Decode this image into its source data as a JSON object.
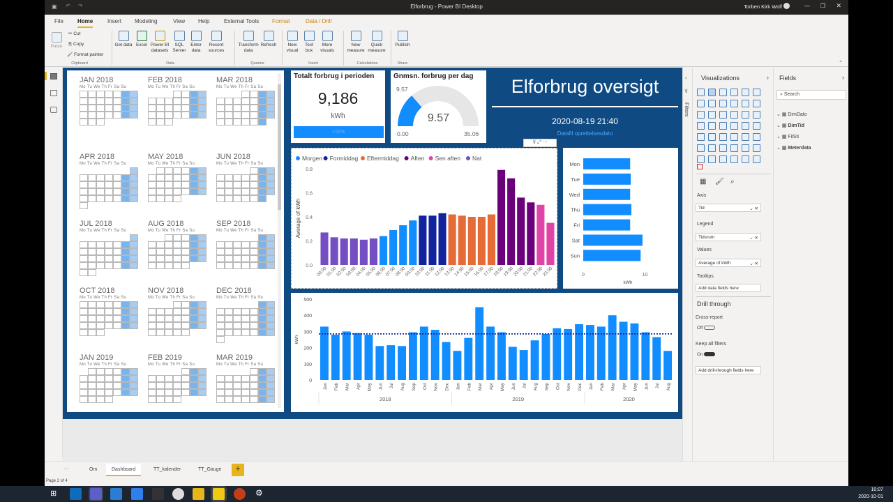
{
  "window": {
    "title": "Elforbrug - Power BI Desktop",
    "user": "Torben Kirk Wolf"
  },
  "ribbon_tabs": [
    "File",
    "Home",
    "Insert",
    "Modeling",
    "View",
    "Help",
    "External Tools",
    "Format",
    "Data / Drill"
  ],
  "ribbon": {
    "clipboard": {
      "paste": "Paste",
      "cut": "Cut",
      "copy": "Copy",
      "format_painter": "Format painter",
      "group": "Clipboard"
    },
    "data": {
      "items": [
        "Get data",
        "Excel",
        "Power BI datasets",
        "SQL Server",
        "Enter data",
        "Recent sources"
      ],
      "group": "Data"
    },
    "queries": {
      "items": [
        "Transform data",
        "Refresh"
      ],
      "group": "Queries"
    },
    "insert": {
      "items": [
        "New visual",
        "Text box",
        "More visuals"
      ],
      "group": "Insert"
    },
    "calculations": {
      "items": [
        "New measure",
        "Quick measure"
      ],
      "group": "Calculations"
    },
    "share": {
      "items": [
        "Publish"
      ],
      "group": "Share"
    }
  },
  "calendar": {
    "dow_header": "Mo Tu We Th Fr Sa Su",
    "months": [
      {
        "name": "JAN 2018",
        "offset": 0,
        "days": 31
      },
      {
        "name": "FEB 2018",
        "offset": 3,
        "days": 28
      },
      {
        "name": "MAR 2018",
        "offset": 3,
        "days": 31
      },
      {
        "name": "APR 2018",
        "offset": 6,
        "days": 30
      },
      {
        "name": "MAY 2018",
        "offset": 1,
        "days": 31
      },
      {
        "name": "JUN 2018",
        "offset": 4,
        "days": 30
      },
      {
        "name": "JUL 2018",
        "offset": 6,
        "days": 31
      },
      {
        "name": "AUG 2018",
        "offset": 2,
        "days": 31
      },
      {
        "name": "SEP 2018",
        "offset": 5,
        "days": 30
      },
      {
        "name": "OCT 2018",
        "offset": 0,
        "days": 31
      },
      {
        "name": "NOV 2018",
        "offset": 3,
        "days": 30
      },
      {
        "name": "DEC 2018",
        "offset": 5,
        "days": 31
      },
      {
        "name": "JAN 2019",
        "offset": 1,
        "days": 31
      },
      {
        "name": "FEB 2019",
        "offset": 4,
        "days": 28
      },
      {
        "name": "MAR 2019",
        "offset": 4,
        "days": 31
      }
    ]
  },
  "kpi": {
    "title": "Totalt forbrug i perioden",
    "value": "9,186",
    "unit": "kWh",
    "bar_text": "100%"
  },
  "gauge": {
    "title": "Gnmsn. forbrug per dag",
    "value": "9.57",
    "target": "9.57",
    "min": "0.00",
    "max": "35.06",
    "fill_fraction": 0.273
  },
  "header": {
    "title": "Elforbrug oversigt",
    "datetime": "2020-08-19 21:40",
    "subtitle": "Datafil oprettelsesdato"
  },
  "hourly_chart": {
    "legend": [
      {
        "name": "Morgen",
        "color": "#118DFF"
      },
      {
        "name": "Formiddag",
        "color": "#12239E"
      },
      {
        "name": "Eftermiddag",
        "color": "#E66C37"
      },
      {
        "name": "Aften",
        "color": "#6B007B"
      },
      {
        "name": "Sen aften",
        "color": "#E044A7"
      },
      {
        "name": "Nat",
        "color": "#744EC2"
      }
    ]
  },
  "chart_data": [
    {
      "type": "bar",
      "ylabel": "Average of kWh",
      "ylim": [
        0,
        0.8
      ],
      "yticks": [
        "0.0",
        "0.2",
        "0.4",
        "0.6",
        "0.8"
      ],
      "categories": [
        "00:00",
        "01:00",
        "02:00",
        "03:00",
        "04:00",
        "05:00",
        "06:00",
        "07:00",
        "08:00",
        "09:00",
        "10:00",
        "11:00",
        "12:00",
        "13:00",
        "14:00",
        "15:00",
        "16:00",
        "17:00",
        "18:00",
        "19:00",
        "20:00",
        "21:00",
        "22:00",
        "23:00"
      ],
      "x_tick_labels": [
        "00:00",
        "01:00",
        "02:00",
        "03:00",
        "04:00",
        "05:00",
        "06:00",
        "07:00",
        "08:00",
        "09:00",
        "10:00",
        "11:00",
        "12:00",
        "13:00",
        "14:00",
        "15:00",
        "16:00",
        "17:00",
        "18:00",
        "19:00",
        "20:00",
        "21:00",
        "22:00",
        "23:00"
      ],
      "values": [
        0.27,
        0.23,
        0.22,
        0.22,
        0.21,
        0.22,
        0.24,
        0.29,
        0.33,
        0.37,
        0.41,
        0.41,
        0.43,
        0.42,
        0.41,
        0.4,
        0.4,
        0.42,
        0.79,
        0.72,
        0.56,
        0.52,
        0.5,
        0.35
      ],
      "series_of_bar": [
        5,
        5,
        5,
        5,
        5,
        5,
        0,
        0,
        0,
        0,
        1,
        1,
        1,
        2,
        2,
        2,
        2,
        2,
        3,
        3,
        3,
        3,
        4,
        4
      ]
    },
    {
      "type": "bar",
      "orientation": "horizontal",
      "categories": [
        "Mon",
        "Tue",
        "Wed",
        "Thu",
        "Fri",
        "Sat",
        "Sun"
      ],
      "values": [
        7.6,
        7.7,
        7.6,
        7.8,
        7.6,
        9.6,
        9.3
      ],
      "xlabel": "kWh",
      "xticks": [
        "0",
        "10"
      ],
      "xlim": [
        0,
        13
      ]
    },
    {
      "type": "bar",
      "ylabel": "kWh",
      "ylim": [
        0,
        500
      ],
      "yticks": [
        "0",
        "100",
        "200",
        "300",
        "400",
        "500"
      ],
      "categories": [
        "Jan",
        "Feb",
        "Mar",
        "Apr",
        "May",
        "Jun",
        "Jul",
        "Aug",
        "Sep",
        "Oct",
        "Nov",
        "Dec",
        "Jan",
        "Feb",
        "Mar",
        "Apr",
        "May",
        "Jun",
        "Jul",
        "Aug",
        "Sep",
        "Oct",
        "Nov",
        "Dec",
        "Jan",
        "Feb",
        "Mar",
        "Apr",
        "May",
        "Jun",
        "Jul",
        "Aug"
      ],
      "x_tick_labels": [
        "Jan",
        "Feb",
        "Mar",
        "Apr",
        "May",
        "Jun",
        "Jul",
        "Aug",
        "Sep",
        "Oct",
        "Nov",
        "Dec",
        "Jan",
        "Feb",
        "Mar",
        "Apr",
        "May",
        "Jun",
        "Jul",
        "Aug",
        "Sep",
        "Oct",
        "Nov",
        "Dec",
        "Jan",
        "Feb",
        "Mar",
        "Apr",
        "May",
        "Jun",
        "Jul",
        "Aug"
      ],
      "years": [
        {
          "label": "2018",
          "start": 0,
          "end": 11
        },
        {
          "label": "2019",
          "start": 12,
          "end": 23
        },
        {
          "label": "2020",
          "start": 24,
          "end": 31
        }
      ],
      "values": [
        330,
        280,
        300,
        290,
        280,
        210,
        215,
        210,
        295,
        330,
        310,
        235,
        180,
        260,
        450,
        330,
        295,
        205,
        185,
        245,
        285,
        320,
        315,
        345,
        340,
        330,
        400,
        360,
        350,
        295,
        265,
        180,
        0
      ],
      "average_line": 285,
      "color": "#118DFF"
    }
  ],
  "visualizations_pane": {
    "title": "Visualizations",
    "axis_label": "Axis",
    "axis_value": "Tid",
    "legend_label": "Legend",
    "legend_value": "Tidsrum",
    "values_label": "Values",
    "values_value": "Average of kWh",
    "tooltips_label": "Tooltips",
    "tooltips_placeholder": "Add data fields here",
    "drill_title": "Drill through",
    "cross_report": "Cross-report",
    "cross_state": "Off",
    "keep_filters": "Keep all filters",
    "keep_state": "On",
    "drill_placeholder": "Add drill-through fields here"
  },
  "filters_label": "Filters",
  "fields_pane": {
    "title": "Fields",
    "search_placeholder": "Search",
    "tables": [
      "DimDato",
      "DimTid",
      "FilSti",
      "Meterdata"
    ]
  },
  "page_tabs": [
    "Om",
    "Dashboard",
    "TT_kalender",
    "TT_Gauge"
  ],
  "active_tab": "Dashboard",
  "status": "Page 2 of 4",
  "taskbar": {
    "time": "10:07",
    "date": "2020-10-01"
  }
}
